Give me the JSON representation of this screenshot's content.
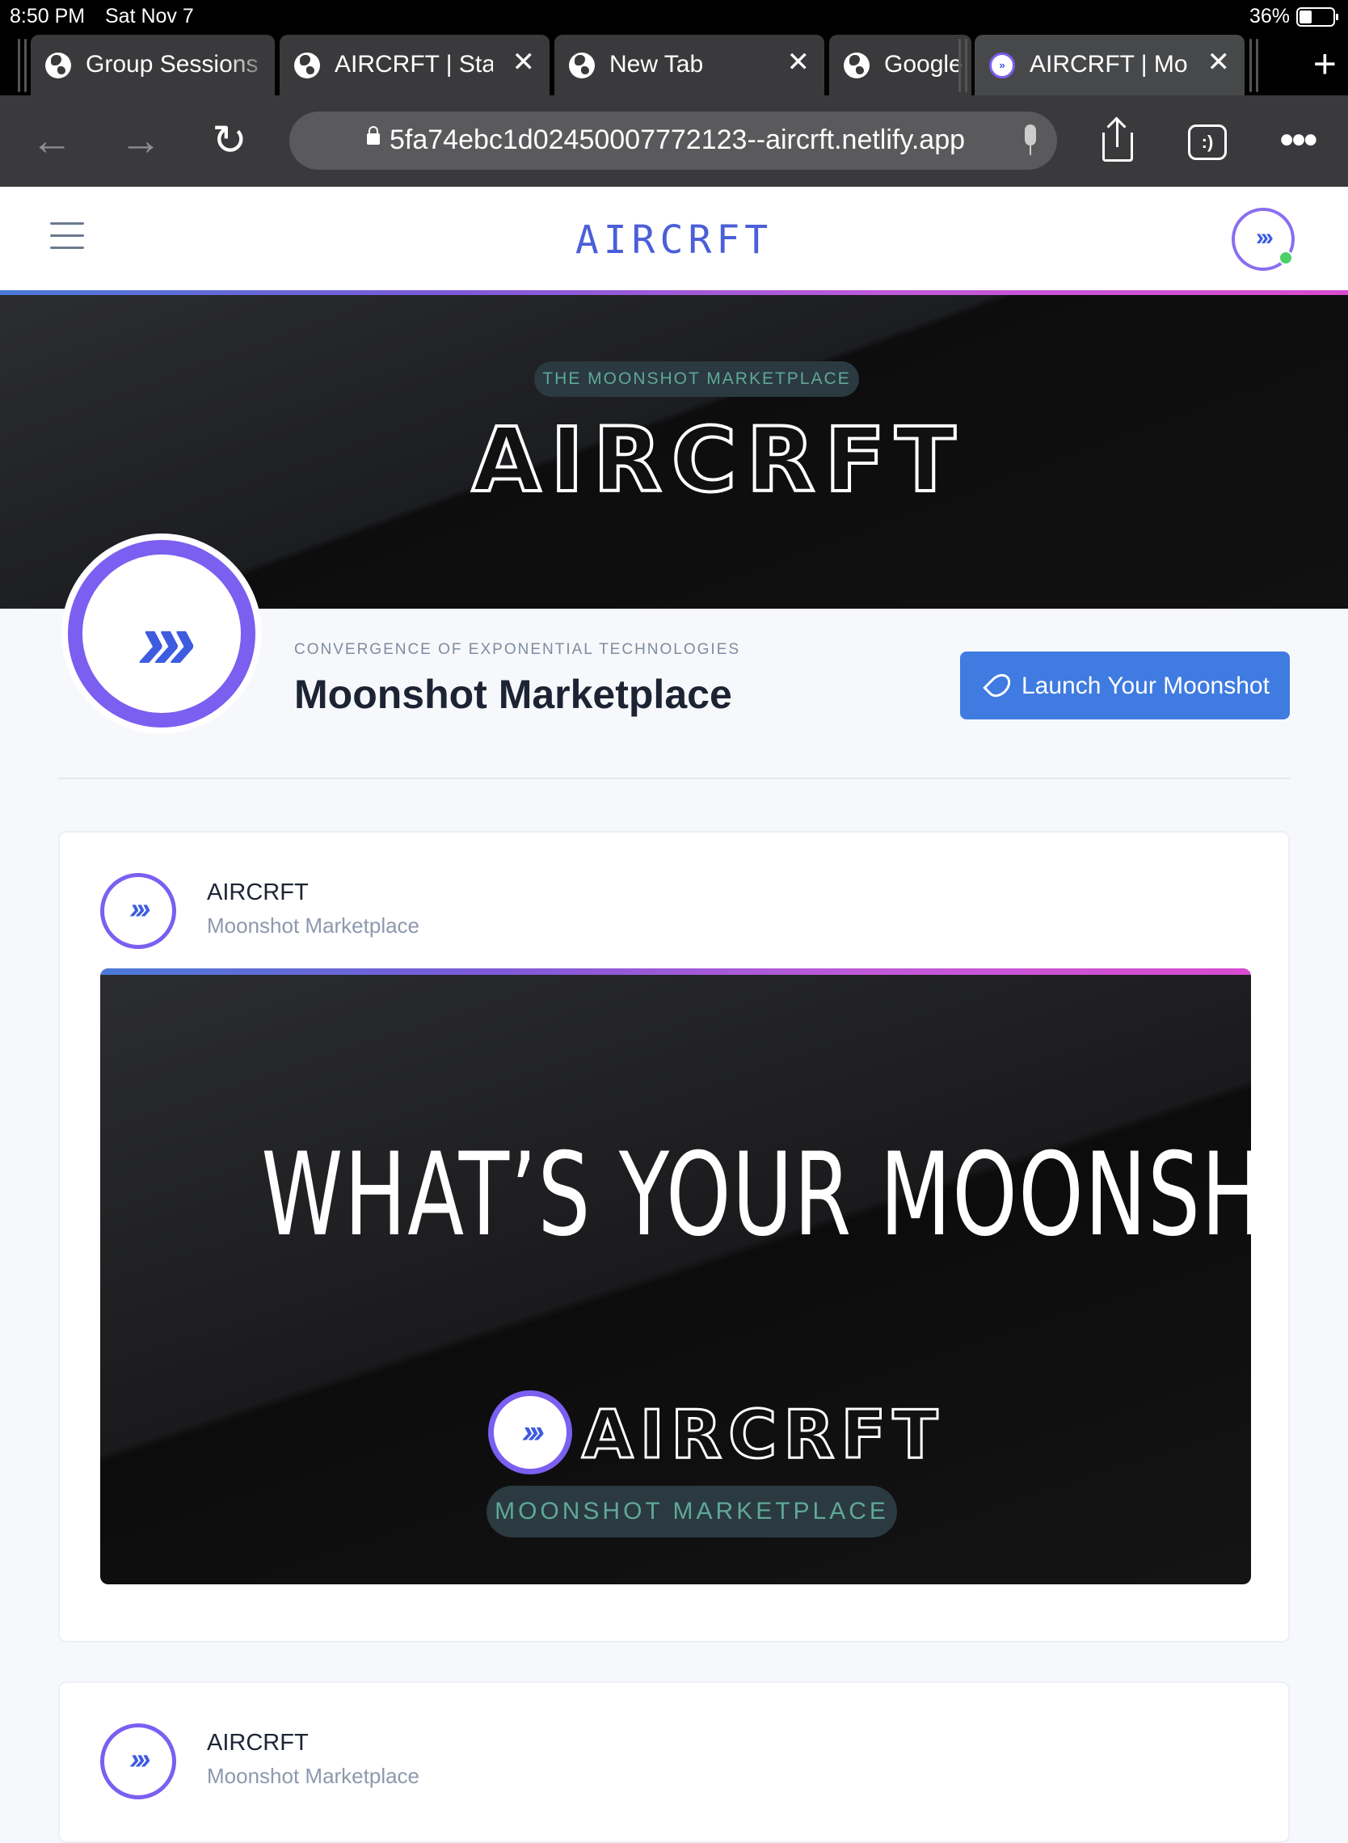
{
  "status_bar": {
    "time": "8:50 PM",
    "date": "Sat Nov 7",
    "battery": "36%"
  },
  "tabs": [
    {
      "title": "Group Sessions",
      "closable": false,
      "icon": "globe-icon"
    },
    {
      "title": "AIRCRFT | Start",
      "closable": true,
      "icon": "globe-icon"
    },
    {
      "title": "New Tab",
      "closable": true,
      "icon": "globe-icon"
    },
    {
      "title": "Google",
      "closable": false,
      "icon": "globe-icon"
    },
    {
      "title": "AIRCRFT | Moon",
      "closable": true,
      "icon": "aircrft-favicon",
      "active": true
    }
  ],
  "toolbar": {
    "url": "5fa74ebc1d02450007772123--aircrft.netlify.app",
    "tabs_badge": ":)"
  },
  "header": {
    "logo": "AIRCRFT"
  },
  "hero": {
    "pill": "THE MOONSHOT MARKETPLACE",
    "wordmark": "AIRCRFT"
  },
  "profile": {
    "kicker": "CONVERGENCE OF EXPONENTIAL TECHNOLOGIES",
    "title": "Moonshot Marketplace",
    "launch_label": "Launch Your Moonshot"
  },
  "posts": [
    {
      "author": "AIRCRFT",
      "subtitle": "Moonshot Marketplace",
      "media": {
        "headline": "WHAT’S YOUR MOONSHOT?",
        "wordmark": "AIRCRFT",
        "pill": "MOONSHOT MARKETPLACE"
      }
    },
    {
      "author": "AIRCRFT",
      "subtitle": "Moonshot Marketplace"
    }
  ],
  "colors": {
    "accent": "#3f7be0",
    "brand_purple": "#7b5ff0",
    "brand_blue": "#3d5ce0",
    "online": "#4cd16a"
  }
}
